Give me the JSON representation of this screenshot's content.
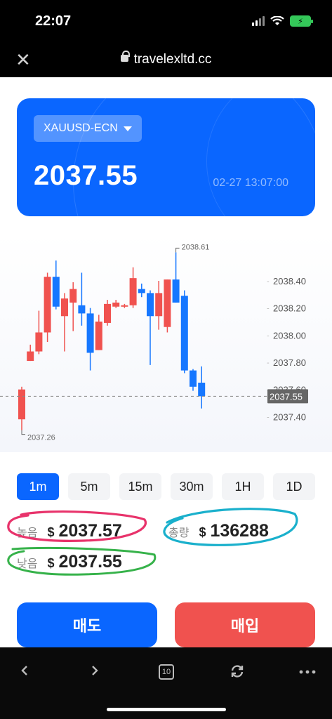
{
  "status_bar": {
    "time": "22:07"
  },
  "browser": {
    "url": "travelexltd.cc",
    "tab_count": "10"
  },
  "price_card": {
    "symbol": "XAUUSD-ECN",
    "price": "2037.55",
    "timestamp": "02-27 13:07:00"
  },
  "chart_data": {
    "type": "candlestick",
    "y_axis_labels": [
      "2038.40",
      "2038.20",
      "2038.00",
      "2037.80",
      "2037.60",
      "2037.40"
    ],
    "ylim": [
      2037.2,
      2038.7
    ],
    "high_label": "2038.61",
    "low_label": "2037.26",
    "current_price_label": "2037.55",
    "current_price": 2037.55,
    "up_color": "#f0524f",
    "down_color": "#1677ff",
    "candles": [
      {
        "open": 2037.38,
        "close": 2037.6,
        "high": 2037.62,
        "low": 2037.3
      },
      {
        "open": 2037.81,
        "close": 2037.88,
        "high": 2037.93,
        "low": 2037.81
      },
      {
        "open": 2037.88,
        "close": 2038.02,
        "high": 2038.18,
        "low": 2037.86
      },
      {
        "open": 2038.02,
        "close": 2038.43,
        "high": 2038.46,
        "low": 2037.95
      },
      {
        "open": 2038.43,
        "close": 2038.21,
        "high": 2038.55,
        "low": 2038.19
      },
      {
        "open": 2038.14,
        "close": 2038.27,
        "high": 2038.31,
        "low": 2037.88
      },
      {
        "open": 2038.24,
        "close": 2038.34,
        "high": 2038.39,
        "low": 2038.03
      },
      {
        "open": 2038.22,
        "close": 2038.16,
        "high": 2038.46,
        "low": 2038.07
      },
      {
        "open": 2038.16,
        "close": 2037.87,
        "high": 2038.2,
        "low": 2037.74
      },
      {
        "open": 2037.89,
        "close": 2038.1,
        "high": 2038.15,
        "low": 2037.89
      },
      {
        "open": 2038.09,
        "close": 2038.23,
        "high": 2038.26,
        "low": 2038.07
      },
      {
        "open": 2038.21,
        "close": 2038.24,
        "high": 2038.26,
        "low": 2038.2
      },
      {
        "open": 2038.22,
        "close": 2038.22,
        "high": 2038.23,
        "low": 2038.2
      },
      {
        "open": 2038.22,
        "close": 2038.42,
        "high": 2038.5,
        "low": 2038.2
      },
      {
        "open": 2038.34,
        "close": 2038.31,
        "high": 2038.38,
        "low": 2038.28
      },
      {
        "open": 2038.31,
        "close": 2038.14,
        "high": 2038.33,
        "low": 2037.78
      },
      {
        "open": 2038.14,
        "close": 2038.31,
        "high": 2038.4,
        "low": 2038.04
      },
      {
        "open": 2038.06,
        "close": 2038.41,
        "high": 2038.41,
        "low": 2038.02
      },
      {
        "open": 2038.41,
        "close": 2038.24,
        "high": 2038.61,
        "low": 2038.24
      },
      {
        "open": 2038.29,
        "close": 2037.74,
        "high": 2038.33,
        "low": 2037.72
      },
      {
        "open": 2037.74,
        "close": 2037.62,
        "high": 2037.75,
        "low": 2037.59
      },
      {
        "open": 2037.65,
        "close": 2037.55,
        "high": 2037.77,
        "low": 2037.46
      }
    ]
  },
  "timeframes": [
    "1m",
    "5m",
    "15m",
    "30m",
    "1H",
    "1D"
  ],
  "active_timeframe": "1m",
  "stats": {
    "high_label": "높음",
    "high_currency": "$",
    "high_value": "2037.57",
    "low_label": "낮음",
    "low_currency": "$",
    "low_value": "2037.55",
    "volume_label": "총량",
    "volume_currency": "$",
    "volume_value": "136288"
  },
  "actions": {
    "sell": "매도",
    "buy": "매입"
  },
  "colors": {
    "accent": "#0a66ff",
    "sell": "#0a66ff",
    "buy": "#f0524f"
  },
  "icons": [
    "close-icon",
    "lock-icon",
    "back-icon",
    "forward-icon",
    "tabs-icon",
    "reload-icon",
    "more-icon"
  ]
}
